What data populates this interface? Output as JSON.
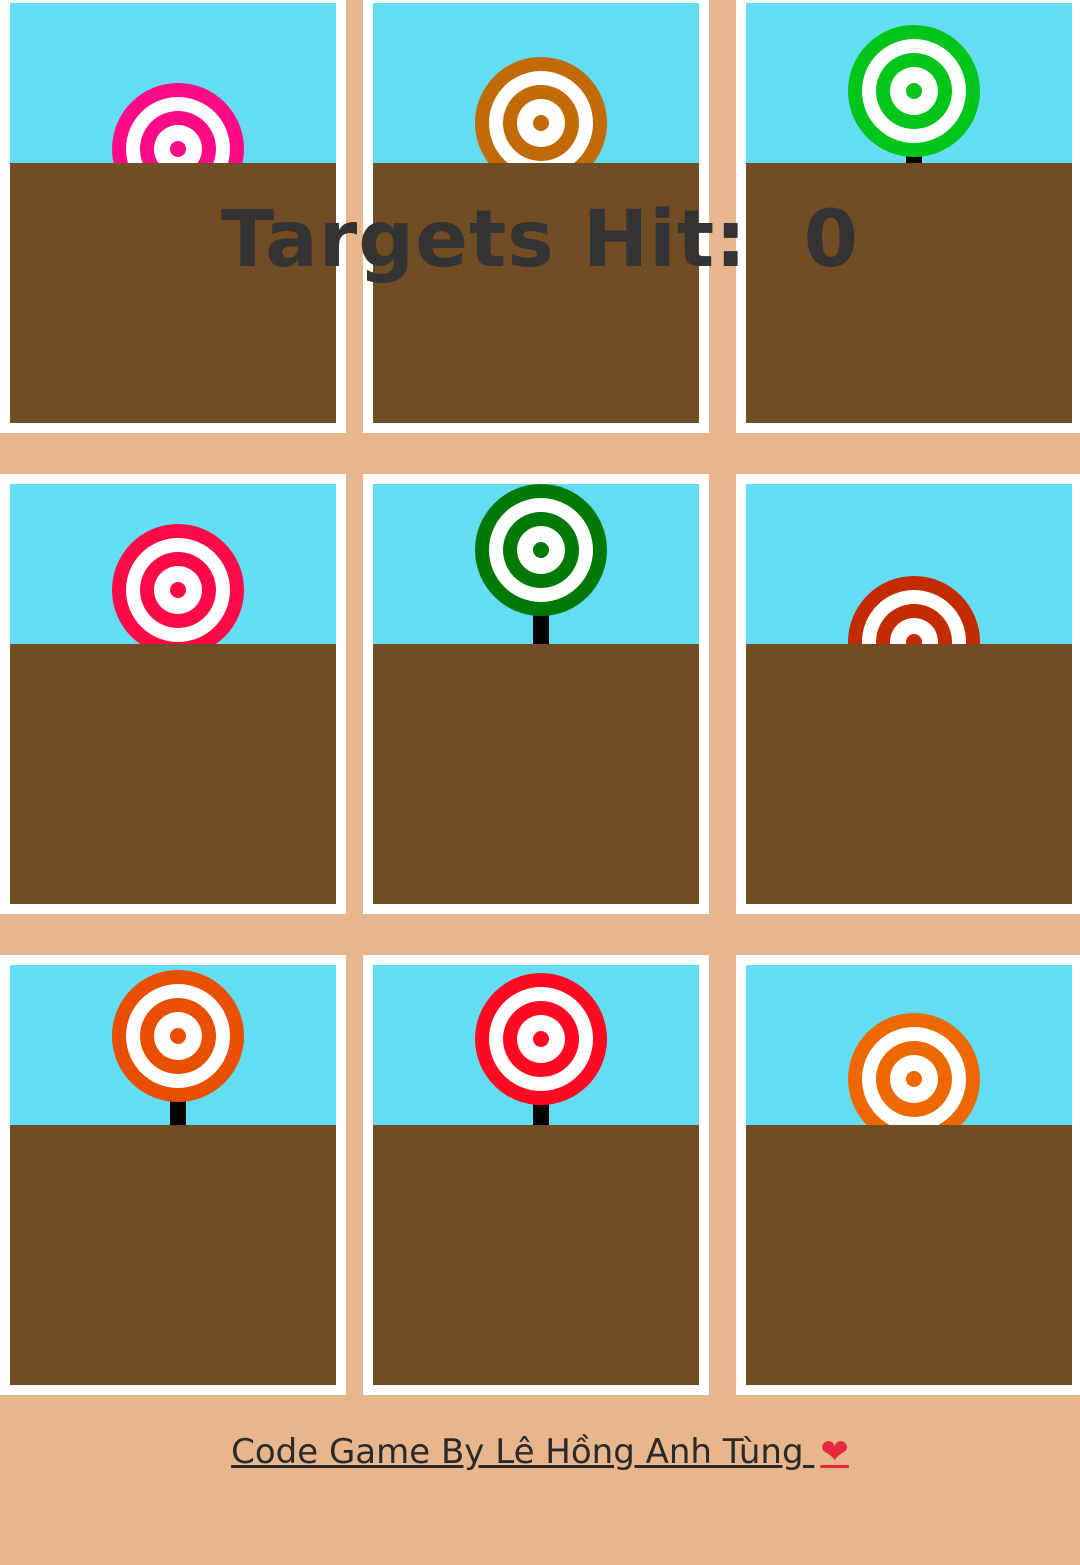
{
  "hud": {
    "label": "Targets Hit:",
    "score": "0"
  },
  "footer": {
    "credit": "Code Game By Lê Hồng Anh Tùng",
    "heart": "❤"
  },
  "colors": {
    "background": "#e8b68c",
    "sky": "#64dcf1",
    "ground": "#724c23",
    "frame": "#ffffff",
    "text": "#333333"
  },
  "cells": [
    {
      "id": "r1c1",
      "target_color": "#ff0a87",
      "has_pole": false
    },
    {
      "id": "r1c2",
      "target_color": "#c26a06",
      "has_pole": false
    },
    {
      "id": "r1c3",
      "target_color": "#00c51a",
      "has_pole": true
    },
    {
      "id": "r2c1",
      "target_color": "#ff0a46",
      "has_pole": false
    },
    {
      "id": "r2c2",
      "target_color": "#007a05",
      "has_pole": true
    },
    {
      "id": "r2c3",
      "target_color": "#c52b00",
      "has_pole": false
    },
    {
      "id": "r3c1",
      "target_color": "#ea4e00",
      "has_pole": true
    },
    {
      "id": "r3c2",
      "target_color": "#ff0a20",
      "has_pole": true
    },
    {
      "id": "r3c3",
      "target_color": "#ee6800",
      "has_pole": false
    }
  ]
}
